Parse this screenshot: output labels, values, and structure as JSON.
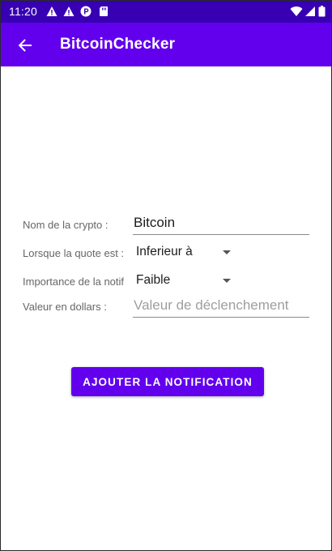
{
  "status_bar": {
    "time": "11:20"
  },
  "app_bar": {
    "title": "BitcoinChecker"
  },
  "form": {
    "crypto_name": {
      "label": "Nom de la crypto :",
      "value": "Bitcoin"
    },
    "quote_condition": {
      "label": "Lorsque la quote est :",
      "selected": "Inferieur à"
    },
    "importance": {
      "label": "Importance de la notif",
      "selected": "Faible"
    },
    "dollar_value": {
      "label": "Valeur en dollars :",
      "placeholder": "Valeur de déclenchement",
      "value": ""
    }
  },
  "actions": {
    "add_notification_label": "AJOUTER LA NOTIFICATION"
  },
  "colors": {
    "primary": "#6200ee",
    "primary_dark": "#3700b3",
    "on_primary": "#ffffff"
  }
}
